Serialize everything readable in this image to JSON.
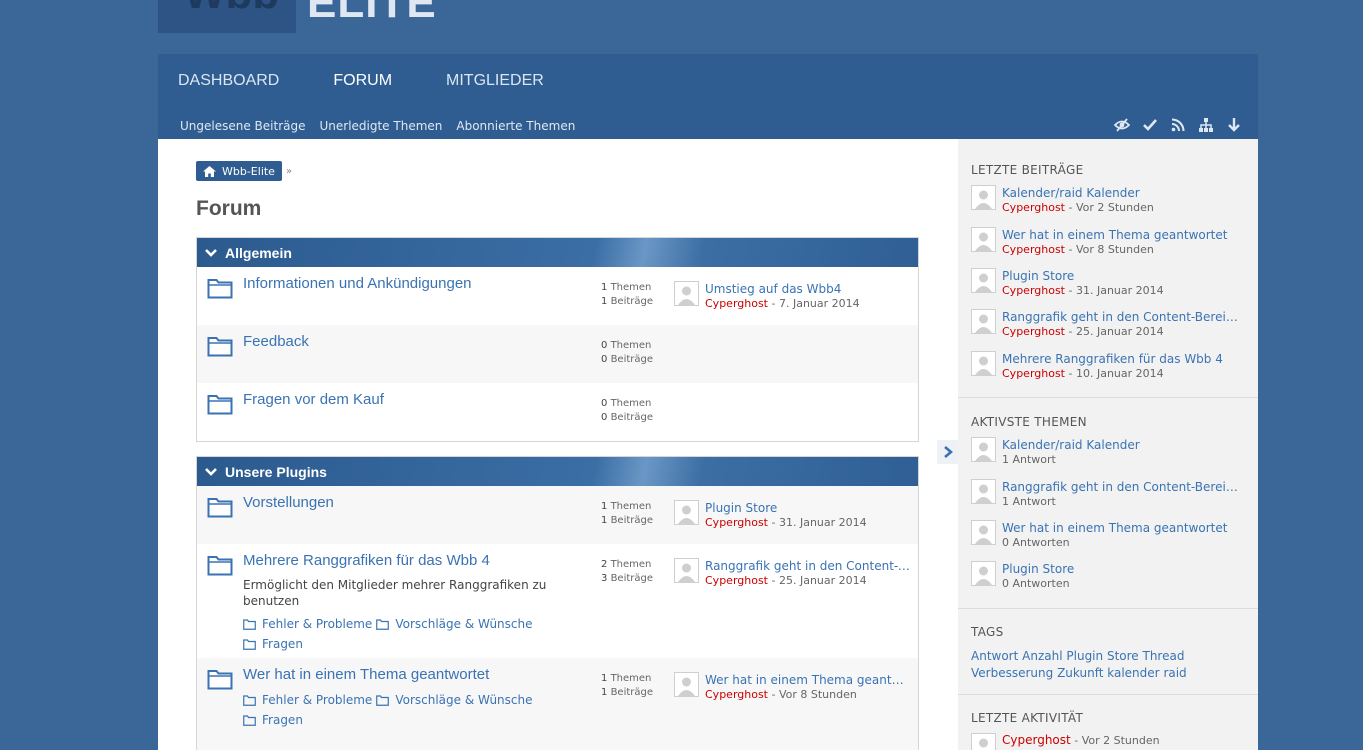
{
  "logo": {
    "box_text": "Wbb",
    "text": "ELITE"
  },
  "nav": {
    "main": [
      {
        "label": "DASHBOARD",
        "active": false
      },
      {
        "label": "FORUM",
        "active": true
      },
      {
        "label": "MITGLIEDER",
        "active": false
      }
    ],
    "sub": [
      "Ungelesene Beiträge",
      "Unerledigte Themen",
      "Abonnierte Themen"
    ],
    "icons": [
      "mark-read-icon",
      "checkmark-icon",
      "rss-icon",
      "sitemap-icon",
      "arrow-down-icon"
    ]
  },
  "breadcrumb": {
    "home": "Wbb-Elite",
    "sep": "»"
  },
  "page_title": "Forum",
  "categories": [
    {
      "title": "Allgemein",
      "boards": [
        {
          "title": "Informationen und Ankündigungen",
          "themen": "1",
          "beitraege": "1",
          "themen_label": "Themen",
          "beitraege_label": "Beiträge",
          "last_title": "Umstieg auf das Wbb4",
          "last_user": "Cyperghost",
          "last_sep": " - ",
          "last_time": "7. Januar 2014"
        },
        {
          "title": "Feedback",
          "themen": "0",
          "beitraege": "0",
          "themen_label": "Themen",
          "beitraege_label": "Beiträge"
        },
        {
          "title": "Fragen vor dem Kauf",
          "themen": "0",
          "beitraege": "0",
          "themen_label": "Themen",
          "beitraege_label": "Beiträge"
        }
      ]
    },
    {
      "title": "Unsere Plugins",
      "boards": [
        {
          "title": "Vorstellungen",
          "themen": "1",
          "beitraege": "1",
          "themen_label": "Themen",
          "beitraege_label": "Beiträge",
          "last_title": "Plugin Store",
          "last_user": "Cyperghost",
          "last_sep": " - ",
          "last_time": "31. Januar 2014"
        },
        {
          "title": "Mehrere Ranggrafiken für das Wbb 4",
          "desc": "Ermöglicht den Mitglieder mehrer Ranggrafiken zu benutzen",
          "themen": "2",
          "beitraege": "3",
          "themen_label": "Themen",
          "beitraege_label": "Beiträge",
          "last_title": "Ranggrafik geht in den Content-Bereich über",
          "last_user": "Cyperghost",
          "last_sep": " - ",
          "last_time": "25. Januar 2014",
          "subs": [
            "Fehler & Probleme",
            "Vorschläge & Wünsche",
            "Fragen"
          ]
        },
        {
          "title": "Wer hat in einem Thema geantwortet",
          "themen": "1",
          "beitraege": "1",
          "themen_label": "Themen",
          "beitraege_label": "Beiträge",
          "last_title": "Wer hat in einem Thema geantwortet",
          "last_user": "Cyperghost",
          "last_sep": " - ",
          "last_time": "Vor 8 Stunden",
          "subs": [
            "Fehler & Probleme",
            "Vorschläge & Wünsche",
            "Fragen"
          ]
        }
      ]
    }
  ],
  "sidebar": {
    "latest_posts": {
      "title": "LETZTE BEITRÄGE",
      "items": [
        {
          "title": "Kalender/raid Kalender",
          "user": "Cyperghost",
          "sep": " - ",
          "time": "Vor 2 Stunden"
        },
        {
          "title": "Wer hat in einem Thema geantwortet",
          "user": "Cyperghost",
          "sep": " - ",
          "time": "Vor 8 Stunden"
        },
        {
          "title": "Plugin Store",
          "user": "Cyperghost",
          "sep": " - ",
          "time": "31. Januar 2014"
        },
        {
          "title": "Ranggrafik geht in den Content-Bereich über",
          "user": "Cyperghost",
          "sep": " - ",
          "time": "25. Januar 2014"
        },
        {
          "title": "Mehrere Ranggrafiken für das Wbb 4",
          "user": "Cyperghost",
          "sep": " - ",
          "time": "10. Januar 2014"
        }
      ]
    },
    "active_threads": {
      "title": "AKTIVSTE THEMEN",
      "items": [
        {
          "title": "Kalender/raid Kalender",
          "replies": "1 Antwort"
        },
        {
          "title": "Ranggrafik geht in den Content-Bereich über",
          "replies": "1 Antwort"
        },
        {
          "title": "Wer hat in einem Thema geantwortet",
          "replies": "0 Antworten"
        },
        {
          "title": "Plugin Store",
          "replies": "0 Antworten"
        }
      ]
    },
    "tags": {
      "title": "TAGS",
      "items": [
        "Antwort",
        "Anzahl",
        "Plugin",
        "Store",
        "Thread",
        "Verbesserung",
        "Zukunft",
        "kalender",
        "raid"
      ]
    },
    "activity": {
      "title": "LETZTE AKTIVITÄT",
      "user": "Cyperghost",
      "sep": " - ",
      "time": "Vor 2 Stunden"
    }
  },
  "colors": {
    "brand": "#2f5d91",
    "background": "#3a6798",
    "link": "#3a73b3",
    "user": "#cc0000"
  }
}
